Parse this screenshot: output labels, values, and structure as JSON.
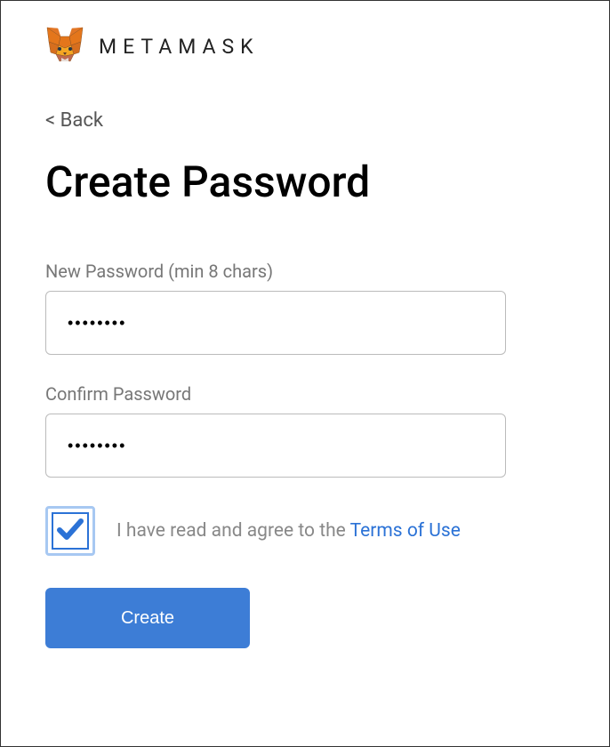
{
  "header": {
    "brand": "METAMASK"
  },
  "nav": {
    "back": "< Back"
  },
  "title": "Create Password",
  "fields": {
    "new_password": {
      "label": "New Password (min 8 chars)",
      "value": "••••••••"
    },
    "confirm_password": {
      "label": "Confirm Password",
      "value": "••••••••"
    }
  },
  "tos": {
    "text": "I have read and agree to the ",
    "link": "Terms of Use",
    "checked": true
  },
  "actions": {
    "create": "Create"
  },
  "colors": {
    "primary": "#3d7dd6",
    "link": "#2b72d6"
  }
}
